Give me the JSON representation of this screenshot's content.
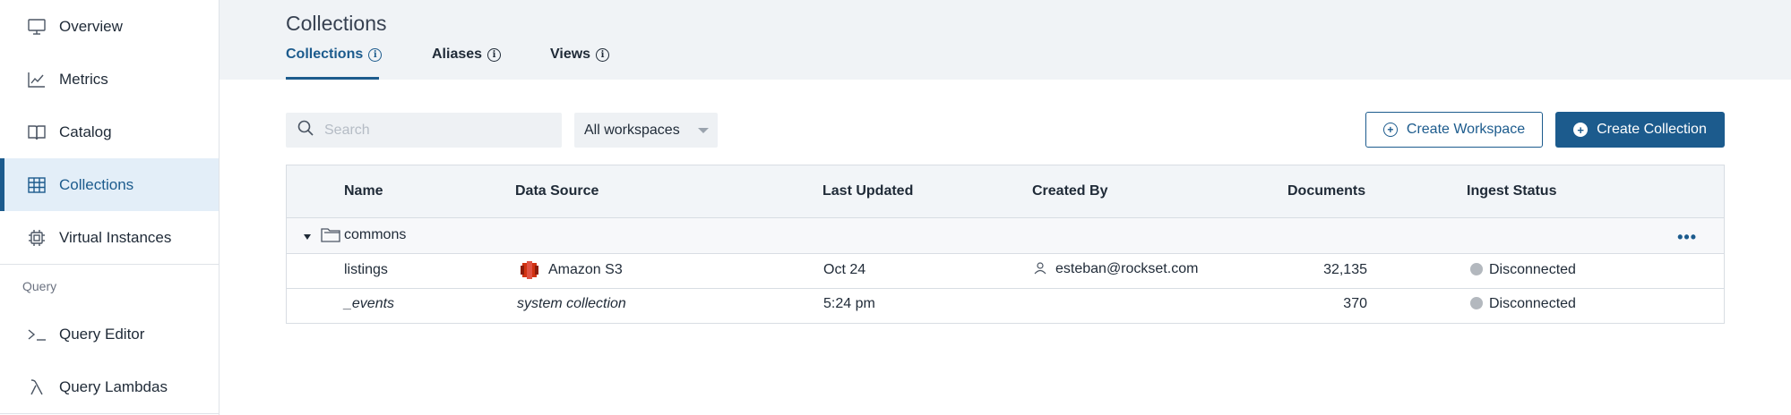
{
  "sidebar": {
    "items": [
      {
        "label": "Overview",
        "icon": "monitor-icon"
      },
      {
        "label": "Metrics",
        "icon": "chart-line-icon"
      },
      {
        "label": "Catalog",
        "icon": "book-icon"
      },
      {
        "label": "Collections",
        "icon": "table-icon",
        "active": true
      },
      {
        "label": "Virtual Instances",
        "icon": "chip-icon"
      }
    ],
    "section_query": "Query",
    "query_items": [
      {
        "label": "Query Editor",
        "icon": "terminal-icon"
      },
      {
        "label": "Query Lambdas",
        "icon": "lambda-icon"
      }
    ]
  },
  "header": {
    "title": "Collections",
    "tabs": [
      {
        "label": "Collections",
        "active": true
      },
      {
        "label": "Aliases"
      },
      {
        "label": "Views"
      }
    ]
  },
  "toolbar": {
    "search_placeholder": "Search",
    "workspace_select": "All workspaces",
    "create_workspace": "Create Workspace",
    "create_collection": "Create Collection"
  },
  "table": {
    "columns": [
      "Name",
      "Data Source",
      "Last Updated",
      "Created By",
      "Documents",
      "Ingest Status"
    ],
    "group": {
      "name": "commons"
    },
    "rows": [
      {
        "name": "listings",
        "source": "Amazon S3",
        "updated": "Oct 24",
        "created_by": "esteban@rockset.com",
        "documents": "32,135",
        "status": "Disconnected"
      },
      {
        "name": "_events",
        "source": "system collection",
        "updated": "5:24 pm",
        "created_by": "",
        "documents": "370",
        "status": "Disconnected"
      }
    ]
  },
  "colors": {
    "accent": "#1c5b8d",
    "active_bg": "#e3eef8",
    "header_bg": "#f0f3f6",
    "status_disconnected": "#b3b8be",
    "s3_red": "#d13212"
  }
}
